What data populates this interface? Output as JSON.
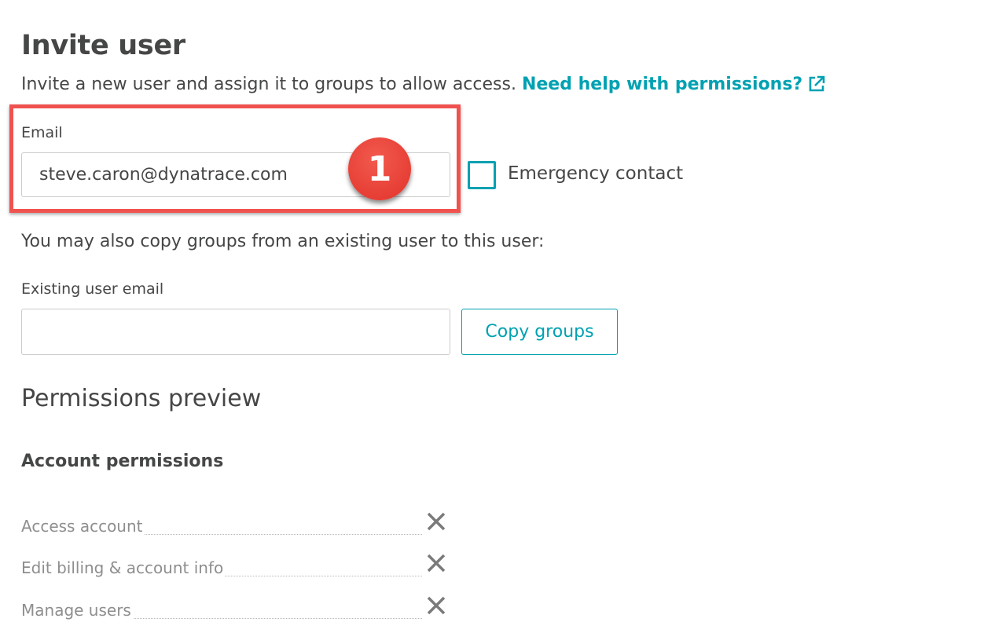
{
  "header": {
    "title": "Invite user",
    "description": "Invite a new user and assign it to groups to allow access. ",
    "help_link": "Need help with permissions?",
    "help_link_icon": "external-link-icon"
  },
  "email_field": {
    "label": "Email",
    "value": "steve.caron@dynatrace.com"
  },
  "annotation": {
    "step_number": "1",
    "color": "#f0524f"
  },
  "emergency_contact": {
    "label": "Emergency contact",
    "checked": false
  },
  "copy_groups": {
    "hint": "You may also copy groups from an existing user to this user:",
    "existing_label": "Existing user email",
    "existing_value": "",
    "button_label": "Copy groups"
  },
  "permissions": {
    "heading": "Permissions preview",
    "account_heading": "Account permissions",
    "items": [
      {
        "label": "Access account",
        "status_icon": "x-icon"
      },
      {
        "label": "Edit billing & account info",
        "status_icon": "x-icon"
      },
      {
        "label": "Manage users",
        "status_icon": "x-icon"
      }
    ]
  },
  "colors": {
    "accent": "#00a1b2",
    "text": "#454646",
    "muted": "#8e8e8e",
    "highlight": "#f0524f"
  }
}
